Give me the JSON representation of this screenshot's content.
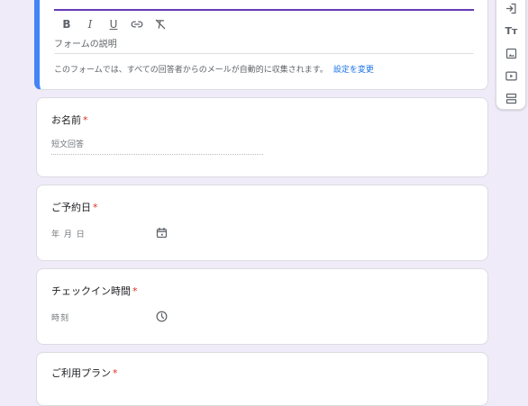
{
  "header": {
    "format_buttons": [
      "B",
      "I",
      "U",
      "link",
      "clear"
    ],
    "description_placeholder": "フォームの説明",
    "notice_text": "このフォームでは、すべての回答者からのメールが自動的に収集されます。",
    "notice_link": "設定を変更"
  },
  "questions": [
    {
      "title": "お名前",
      "required_mark": "*",
      "field_text": "短文回答"
    },
    {
      "title": "ご予約日",
      "required_mark": "*",
      "field_text": "年 月 日"
    },
    {
      "title": "チェックイン時間",
      "required_mark": "*",
      "field_text": "時刻"
    },
    {
      "title": "ご利用プラン",
      "required_mark": "*"
    }
  ],
  "toolbar": {
    "icons": [
      "import-questions-icon",
      "add-title-icon",
      "add-image-icon",
      "add-video-icon",
      "add-section-icon"
    ],
    "add_title_glyph": "Tт"
  },
  "colors": {
    "background": "#f0ebf8",
    "accent": "#673ab7",
    "header_border": "#4285f4",
    "required": "#d93025",
    "link": "#1a73e8"
  }
}
